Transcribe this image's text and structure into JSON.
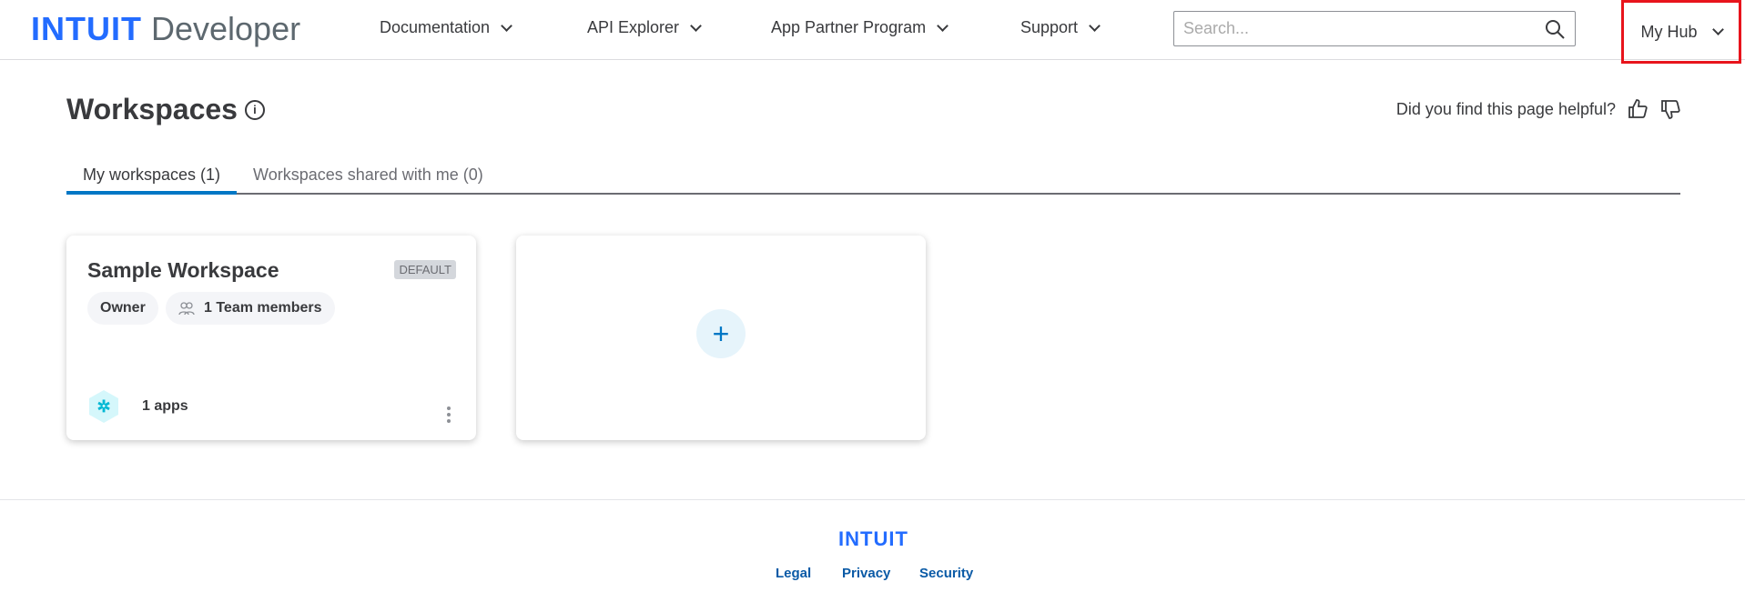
{
  "header": {
    "logo_brand": "INTUIT",
    "logo_product": "Developer",
    "nav": [
      "Documentation",
      "API Explorer",
      "App Partner Program",
      "Support"
    ],
    "search_placeholder": "Search...",
    "my_hub": "My Hub"
  },
  "page": {
    "title": "Workspaces",
    "helpful_prompt": "Did you find this page helpful?",
    "tabs": [
      "My workspaces (1)",
      "Workspaces shared with me (0)"
    ]
  },
  "workspace": {
    "name": "Sample Workspace",
    "badge": "DEFAULT",
    "role": "Owner",
    "members": "1 Team members",
    "apps": "1 apps"
  },
  "footer": {
    "logo": "INTUIT",
    "links": [
      "Legal",
      "Privacy",
      "Security"
    ]
  },
  "colors": {
    "brand": "#236cff",
    "accent": "#0077c5",
    "highlight": "#e8141c"
  }
}
